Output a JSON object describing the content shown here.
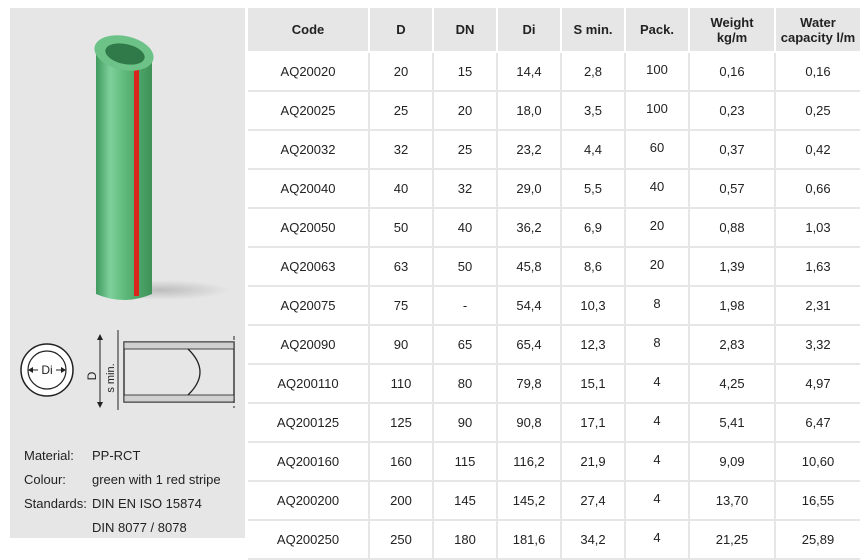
{
  "specs": {
    "material_label": "Material:",
    "material_value": "PP-RCT",
    "colour_label": "Colour:",
    "colour_value": "green with 1 red stripe",
    "standards_label": "Standards:",
    "standards_value_1": "DIN EN ISO 15874",
    "standards_value_2": "DIN 8077 / 8078"
  },
  "diagram": {
    "di_label": "Di",
    "d_label": "D",
    "smin_label": "s min."
  },
  "colors": {
    "pipe_green": "#5fba7d",
    "stripe_red": "#d9261c",
    "panel_grey": "#e6e6e7"
  },
  "table": {
    "headers": {
      "code": "Code",
      "d": "D",
      "dn": "DN",
      "di": "Di",
      "smin": "S min.",
      "pack": "Pack.",
      "weight_1": "Weight",
      "weight_2": "kg/m",
      "water_1": "Water",
      "water_2": "capacity l/m"
    },
    "rows": [
      {
        "code": "AQ20020",
        "d": "20",
        "dn": "15",
        "di": "14,4",
        "smin": "2,8",
        "pack": "100",
        "weight": "0,16",
        "water": "0,16"
      },
      {
        "code": "AQ20025",
        "d": "25",
        "dn": "20",
        "di": "18,0",
        "smin": "3,5",
        "pack": "100",
        "weight": "0,23",
        "water": "0,25"
      },
      {
        "code": "AQ20032",
        "d": "32",
        "dn": "25",
        "di": "23,2",
        "smin": "4,4",
        "pack": "60",
        "weight": "0,37",
        "water": "0,42"
      },
      {
        "code": "AQ20040",
        "d": "40",
        "dn": "32",
        "di": "29,0",
        "smin": "5,5",
        "pack": "40",
        "weight": "0,57",
        "water": "0,66"
      },
      {
        "code": "AQ20050",
        "d": "50",
        "dn": "40",
        "di": "36,2",
        "smin": "6,9",
        "pack": "20",
        "weight": "0,88",
        "water": "1,03"
      },
      {
        "code": "AQ20063",
        "d": "63",
        "dn": "50",
        "di": "45,8",
        "smin": "8,6",
        "pack": "20",
        "weight": "1,39",
        "water": "1,63"
      },
      {
        "code": "AQ20075",
        "d": "75",
        "dn": "-",
        "di": "54,4",
        "smin": "10,3",
        "pack": "8",
        "weight": "1,98",
        "water": "2,31"
      },
      {
        "code": "AQ20090",
        "d": "90",
        "dn": "65",
        "di": "65,4",
        "smin": "12,3",
        "pack": "8",
        "weight": "2,83",
        "water": "3,32"
      },
      {
        "code": "AQ200110",
        "d": "110",
        "dn": "80",
        "di": "79,8",
        "smin": "15,1",
        "pack": "4",
        "weight": "4,25",
        "water": "4,97"
      },
      {
        "code": "AQ200125",
        "d": "125",
        "dn": "90",
        "di": "90,8",
        "smin": "17,1",
        "pack": "4",
        "weight": "5,41",
        "water": "6,47"
      },
      {
        "code": "AQ200160",
        "d": "160",
        "dn": "115",
        "di": "116,2",
        "smin": "21,9",
        "pack": "4",
        "weight": "9,09",
        "water": "10,60"
      },
      {
        "code": "AQ200200",
        "d": "200",
        "dn": "145",
        "di": "145,2",
        "smin": "27,4",
        "pack": "4",
        "weight": "13,70",
        "water": "16,55"
      },
      {
        "code": "AQ200250",
        "d": "250",
        "dn": "180",
        "di": "181,6",
        "smin": "34,2",
        "pack": "4",
        "weight": "21,25",
        "water": "25,89"
      }
    ]
  }
}
